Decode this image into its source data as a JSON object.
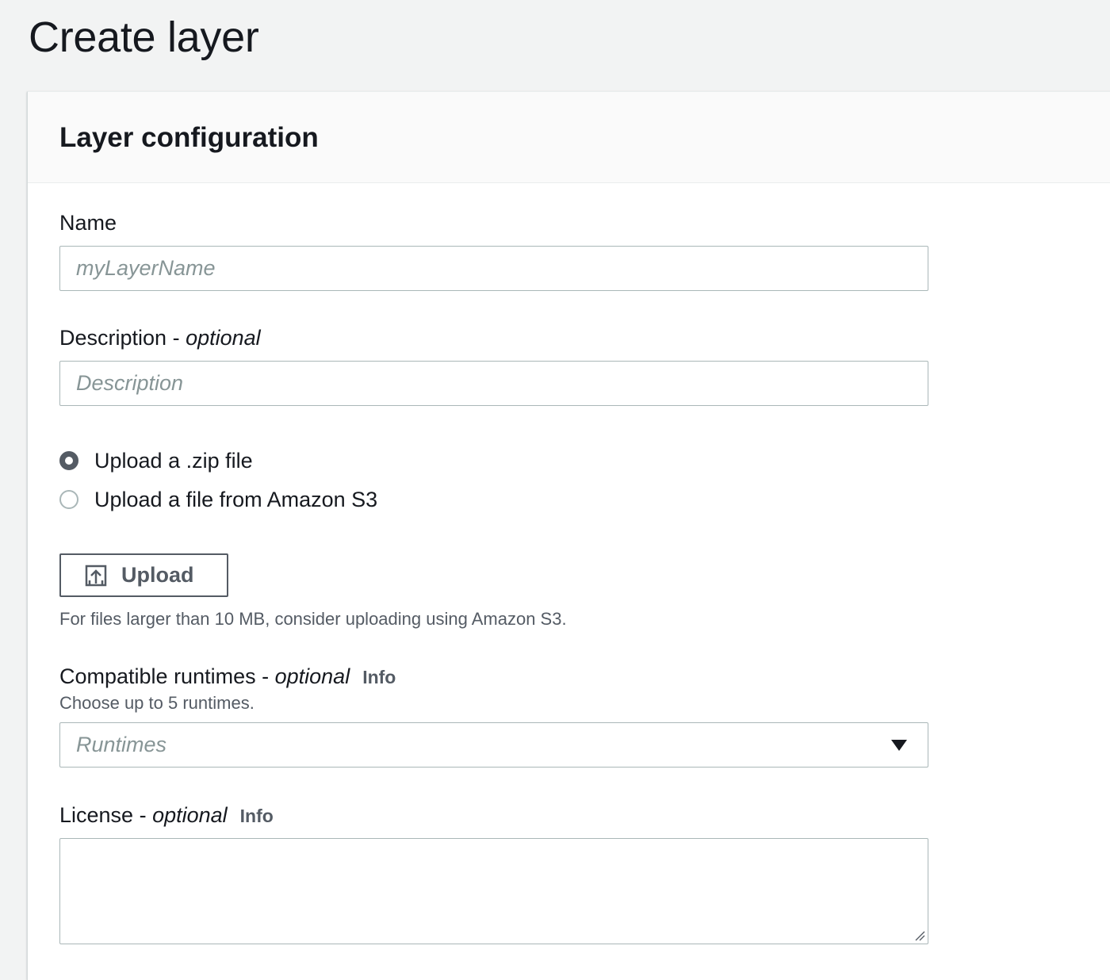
{
  "page": {
    "title": "Create layer"
  },
  "panel": {
    "title": "Layer configuration"
  },
  "name_field": {
    "label": "Name",
    "placeholder": "myLayerName",
    "value": ""
  },
  "description_field": {
    "label": "Description",
    "separator": " - ",
    "optional": "optional",
    "placeholder": "Description",
    "value": ""
  },
  "upload_options": [
    {
      "label": "Upload a .zip file",
      "selected": true
    },
    {
      "label": "Upload a file from Amazon S3",
      "selected": false
    }
  ],
  "upload_button": {
    "label": "Upload",
    "icon": "upload-icon"
  },
  "upload_hint": "For files larger than 10 MB, consider uploading using Amazon S3.",
  "runtimes_field": {
    "label": "Compatible runtimes",
    "separator": " - ",
    "optional": "optional",
    "info": "Info",
    "hint": "Choose up to 5 runtimes.",
    "placeholder": "Runtimes",
    "icon": "caret-down-icon"
  },
  "license_field": {
    "label": "License",
    "separator": " - ",
    "optional": "optional",
    "info": "Info",
    "value": ""
  },
  "colors": {
    "page_background": "#f2f3f3",
    "text": "#16191f",
    "secondary_text": "#545b64",
    "placeholder": "#879596",
    "border": "#aab7b8"
  }
}
